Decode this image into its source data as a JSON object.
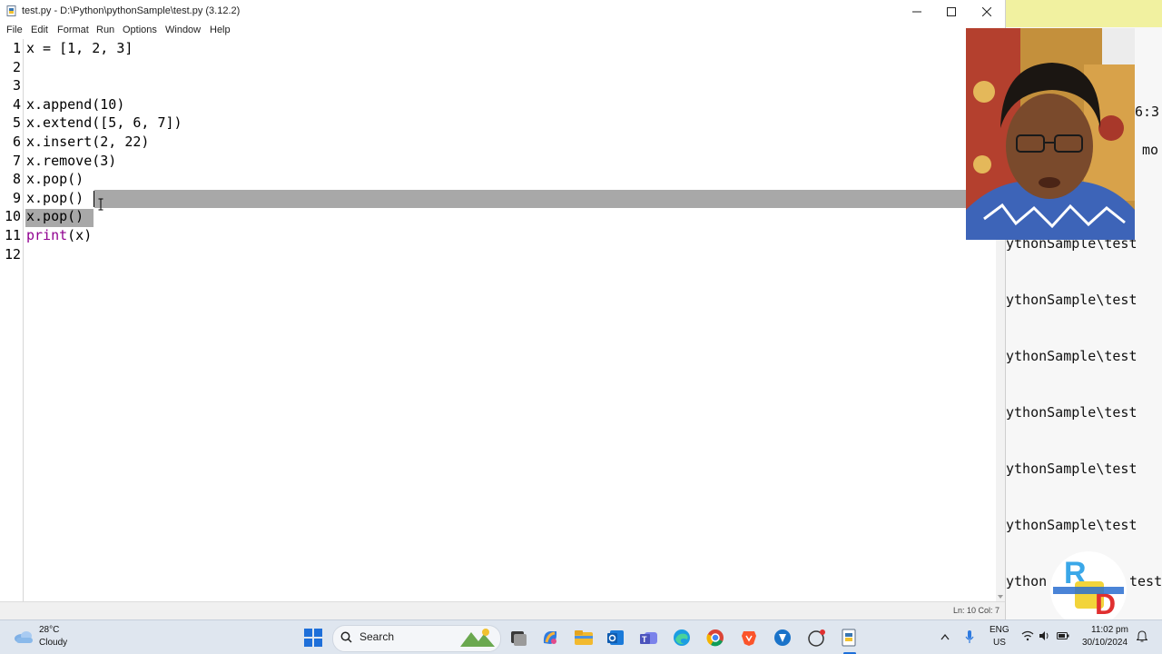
{
  "window": {
    "title": "test.py - D:\\Python\\pythonSample\\test.py (3.12.2)",
    "minimize": "—",
    "maximize": "☐",
    "close": "✕"
  },
  "menu": [
    {
      "label": "File"
    },
    {
      "label": "Edit"
    },
    {
      "label": "Format"
    },
    {
      "label": "Run"
    },
    {
      "label": "Options"
    },
    {
      "label": "Window"
    },
    {
      "label": "Help"
    }
  ],
  "editor": {
    "lines": [
      {
        "num": "1",
        "text": "x = [1, 2, 3]"
      },
      {
        "num": "2",
        "text": ""
      },
      {
        "num": "3",
        "text": ""
      },
      {
        "num": "4",
        "text": "x.append(10)"
      },
      {
        "num": "5",
        "text": "x.extend([5, 6, 7])"
      },
      {
        "num": "6",
        "text": "x.insert(2, 22)"
      },
      {
        "num": "7",
        "text": "x.remove(3)"
      },
      {
        "num": "8",
        "text": "x.pop()"
      },
      {
        "num": "9",
        "text": "x.pop()"
      },
      {
        "num": "10",
        "text": "x.pop()"
      },
      {
        "num": "11",
        "kw": "print",
        "rest": "(x)"
      },
      {
        "num": "12",
        "text": ""
      }
    ],
    "keyword_color": "#900090",
    "selection_color": "#a8a8a8"
  },
  "status": {
    "position": "Ln: 10   Col: 7"
  },
  "background_window": {
    "top_texts": [
      "6:3",
      "mo"
    ],
    "repeated_text": "ythonSample\\test",
    "last_text_left": "ython",
    "last_text_right": "test"
  },
  "taskbar": {
    "weather_temp": "28°C",
    "weather_cond": "Cloudy",
    "search_placeholder": "Search",
    "lang_top": "ENG",
    "lang_bottom": "US",
    "time": "11:02 pm",
    "date": "30/10/2024"
  },
  "colors": {
    "start_blue": "#1e6fd9",
    "taskbar_bg": "#dfe6ef"
  }
}
